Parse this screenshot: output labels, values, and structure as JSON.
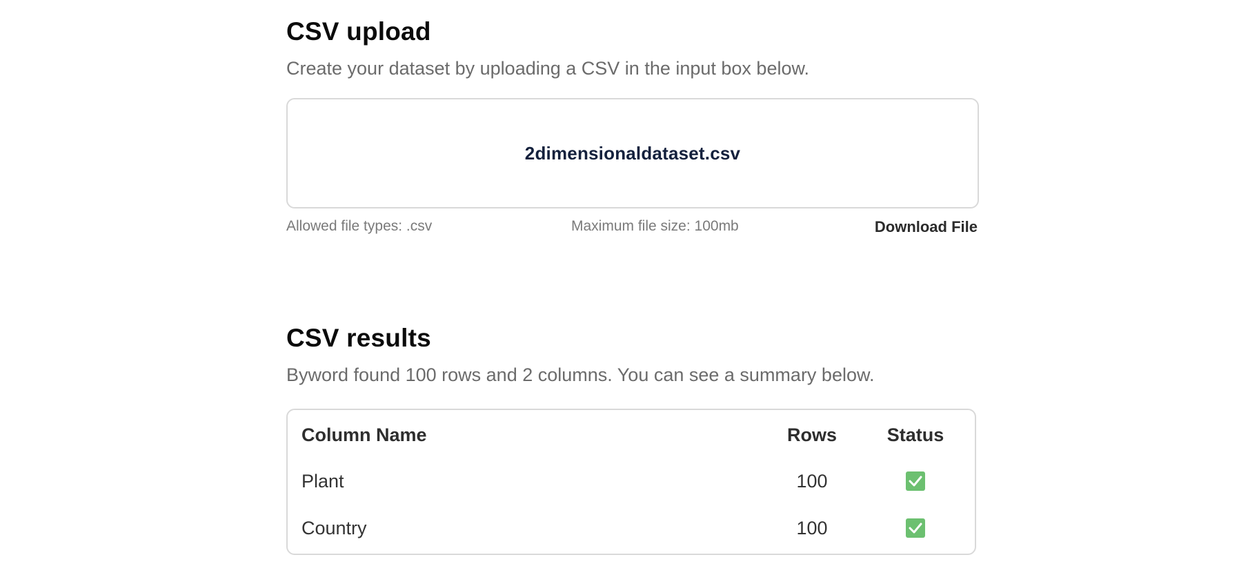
{
  "upload": {
    "title": "CSV upload",
    "description": "Create your dataset by uploading a CSV in the input box below.",
    "filename": "2dimensionaldataset.csv",
    "allowed_types": "Allowed file types: .csv",
    "max_size": "Maximum file size: 100mb",
    "download_label": "Download File"
  },
  "results": {
    "title": "CSV results",
    "description": "Byword found 100 rows and 2 columns. You can see a summary below.",
    "columns": {
      "name": "Column Name",
      "rows": "Rows",
      "status": "Status"
    },
    "rows": [
      {
        "name": "Plant",
        "rows": "100",
        "status": "check-icon"
      },
      {
        "name": "Country",
        "rows": "100",
        "status": "check-icon"
      }
    ]
  },
  "colors": {
    "status_ok": "#6cc070",
    "filename": "#14213d"
  }
}
